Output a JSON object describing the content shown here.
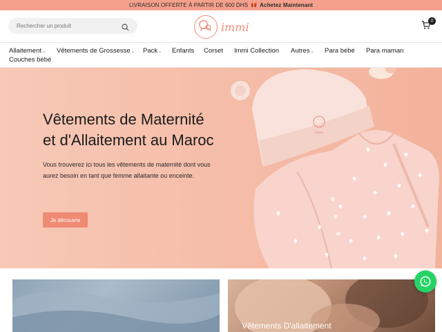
{
  "announcement": {
    "text": "LIVRAISON OFFERTE À PARTIR DE 600 DHS",
    "gift_icon": "gift-icon",
    "cta": "Achetez Maintenant"
  },
  "header": {
    "search_placeholder": "Rechercher un produit",
    "logo_text": "immi",
    "cart_count": "0"
  },
  "nav": {
    "items": [
      {
        "label": "Allaitement",
        "has_dropdown": true
      },
      {
        "label": "Vêtements de Grossesse",
        "has_dropdown": true
      },
      {
        "label": "Pack",
        "has_dropdown": true
      },
      {
        "label": "Enfants",
        "has_dropdown": false
      },
      {
        "label": "Corset",
        "has_dropdown": false
      },
      {
        "label": "Immi Collection",
        "has_dropdown": false
      },
      {
        "label": "Autres",
        "has_dropdown": true
      },
      {
        "label": "Para bébé",
        "has_dropdown": false
      },
      {
        "label": "Para maman",
        "has_dropdown": false
      },
      {
        "label": "Couches bébé",
        "has_dropdown": false
      }
    ]
  },
  "hero": {
    "title_line1": "Vêtements de Maternité",
    "title_line2": "et d'Allaitement au Maroc",
    "description": "Vous trouverez ici tous les vêtements de maternité dont vous aurez besoin en tant que femme allaitante ou enceinte.",
    "button": "Je découvre",
    "hat_brand": "immi"
  },
  "cards": [
    {
      "label": ""
    },
    {
      "label": "Vêtements D'allaitement"
    }
  ],
  "colors": {
    "accent": "#ef8a73",
    "announcement_bg": "#f4a08c",
    "hero_bg": "#f5bca7",
    "whatsapp": "#25d366"
  }
}
